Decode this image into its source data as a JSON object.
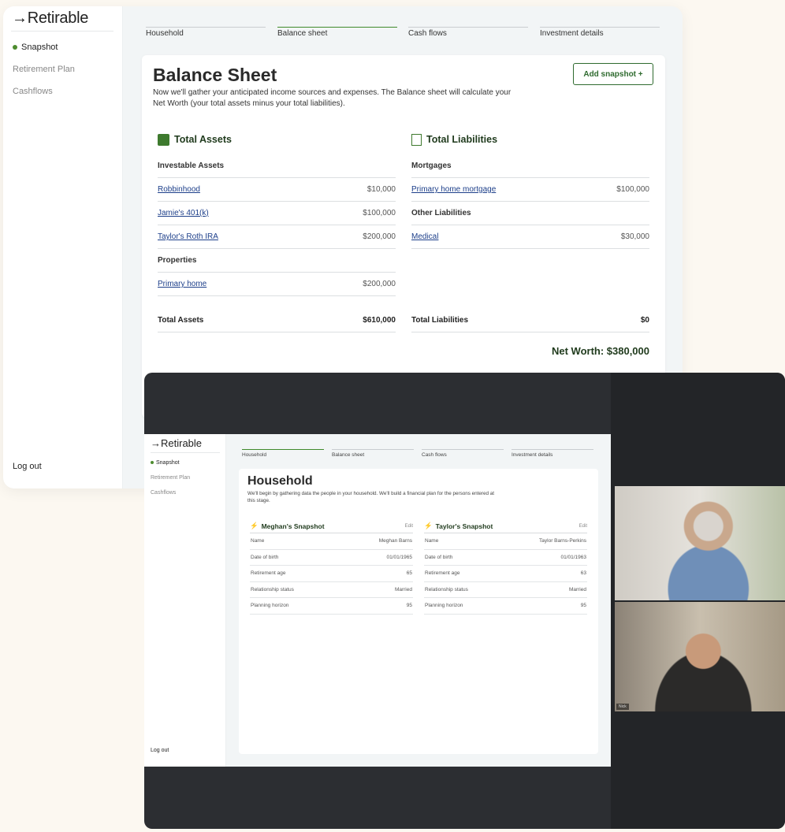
{
  "app": {
    "logo": "→Retirable",
    "nav": [
      "Snapshot",
      "Retirement Plan",
      "Cashflows"
    ],
    "logout": "Log out"
  },
  "colors": {
    "accent": "#3f8a2b",
    "heading": "#1f3a1c",
    "link": "#1d3f8a",
    "dark_window": "#2c2e32"
  },
  "tabs": [
    "Household",
    "Balance sheet",
    "Cash flows",
    "Investment details"
  ],
  "balance": {
    "title": "Balance Sheet",
    "description": "Now we'll gather your anticipated income sources and expenses. The Balance sheet will calculate your Net Worth (your total assets minus your total liabilities).",
    "add_button": "Add snapshot +",
    "assets": {
      "title": "Total Assets",
      "icon": "money-shield-icon",
      "groups": [
        {
          "name": "Investable Assets",
          "items": [
            {
              "label": "Robbinhood",
              "value": "$10,000"
            },
            {
              "label": "Jamie's 401(k)",
              "value": "$100,000"
            },
            {
              "label": "Taylor's Roth IRA",
              "value": "$200,000"
            }
          ]
        },
        {
          "name": "Properties",
          "items": [
            {
              "label": "Primary home",
              "value": "$200,000"
            }
          ]
        }
      ],
      "total_label": "Total Assets",
      "total_value": "$610,000"
    },
    "liabilities": {
      "title": "Total Liabilities",
      "icon": "ledger-icon",
      "groups": [
        {
          "name": "Mortgages",
          "items": [
            {
              "label": "Primary home mortgage",
              "value": "$100,000"
            }
          ]
        },
        {
          "name": "Other Liabilities",
          "items": [
            {
              "label": "Medical",
              "value": "$30,000"
            }
          ]
        }
      ],
      "total_label": "Total Liabilities",
      "total_value": "$0"
    },
    "net_worth": "Net Worth: $380,000"
  },
  "household": {
    "title": "Household",
    "description": "We'll begin by gathering data the people in your household. We'll build a financial plan for the persons entered at this stage.",
    "edit": "Edit",
    "people": [
      {
        "title": "Meghan's Snapshot",
        "rows": [
          [
            "Name",
            "Meghan Barns"
          ],
          [
            "Date of birth",
            "01/01/1965"
          ],
          [
            "Retirement age",
            "65"
          ],
          [
            "Relationship status",
            "Married"
          ],
          [
            "Planning horizon",
            "95"
          ]
        ]
      },
      {
        "title": "Taylor's Snapshot",
        "rows": [
          [
            "Name",
            "Taylor Barns-Perkins"
          ],
          [
            "Date of birth",
            "01/01/1963"
          ],
          [
            "Retirement age",
            "63"
          ],
          [
            "Relationship status",
            "Married"
          ],
          [
            "Planning horizon",
            "95"
          ]
        ]
      }
    ]
  },
  "video": {
    "participant_label": "Nick"
  }
}
